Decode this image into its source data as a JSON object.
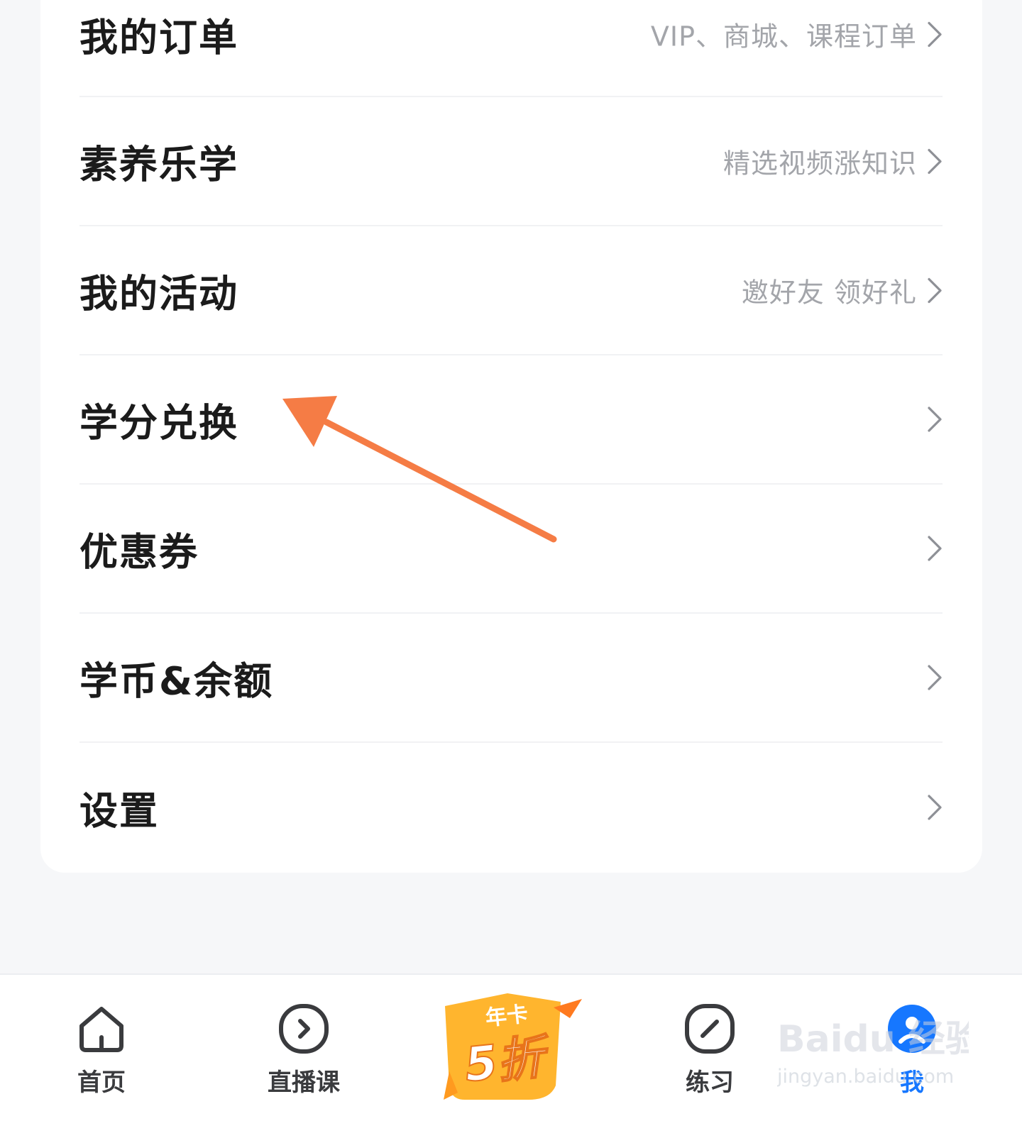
{
  "menu": [
    {
      "label": "我的订单",
      "hint": "VIP、商城、课程订单"
    },
    {
      "label": "素养乐学",
      "hint": "精选视频涨知识"
    },
    {
      "label": "我的活动",
      "hint": "邀好友 领好礼"
    },
    {
      "label": "学分兑换",
      "hint": ""
    },
    {
      "label": "优惠券",
      "hint": ""
    },
    {
      "label": "学币&余额",
      "hint": ""
    },
    {
      "label": "设置",
      "hint": ""
    }
  ],
  "tabbar": {
    "home": "首页",
    "live": "直播课",
    "promo_top": "年卡",
    "promo_big": "5折",
    "practice": "练习",
    "me": "我"
  },
  "watermark": {
    "brand": "Baidu 经验",
    "url": "jingyan.baidu.com"
  },
  "colors": {
    "accent_blue": "#1677ff",
    "annotation_arrow": "#f57c45",
    "promo_orange": "#ff9a1f"
  }
}
